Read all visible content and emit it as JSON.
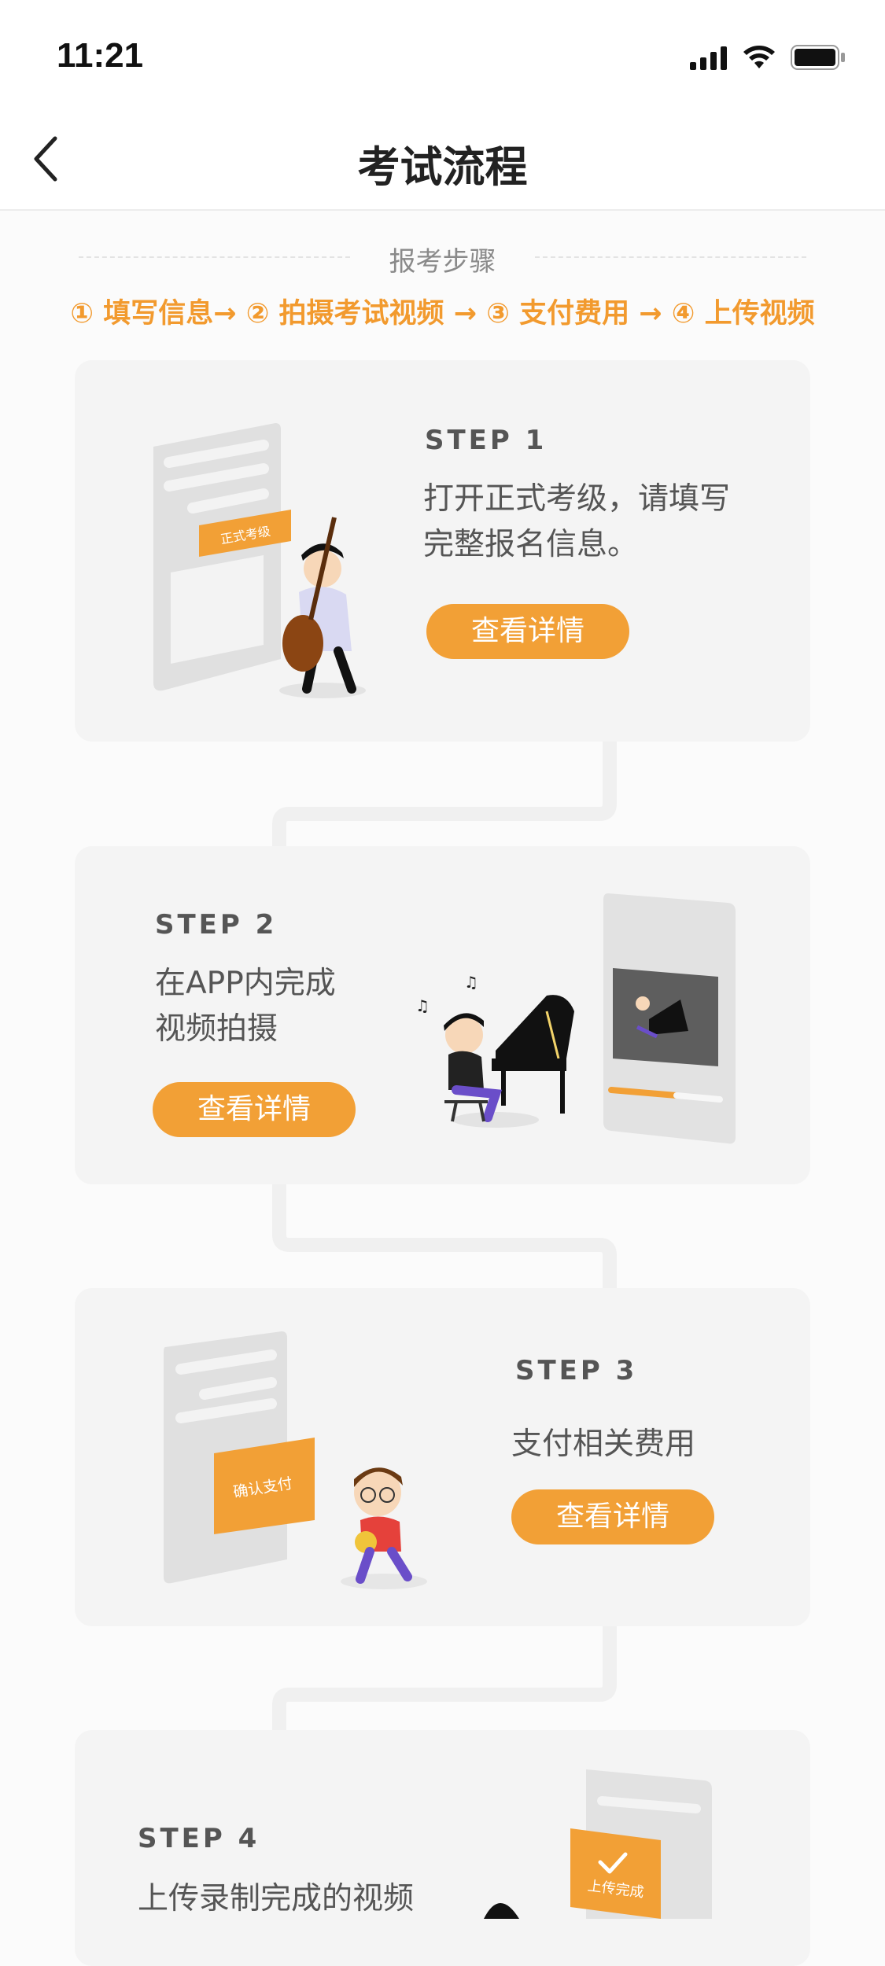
{
  "status_bar": {
    "time": "11:21",
    "icons": [
      "signal-icon",
      "wifi-icon",
      "battery-icon"
    ]
  },
  "nav": {
    "title": "考试流程",
    "back_icon": "chevron-left-icon"
  },
  "section": {
    "label": "报考步骤",
    "flow": "① 填写信息→ ② 拍摄考试视频 → ③ 支付费用 → ④ 上传视频"
  },
  "steps": [
    {
      "label": "STEP 1",
      "desc_line1": "打开正式考级，请填写",
      "desc_line2": "完整报名信息。",
      "button": "查看详情",
      "tag": "正式考级"
    },
    {
      "label": "STEP 2",
      "desc_line1": "在APP内完成",
      "desc_line2": "视频拍摄",
      "button": "查看详情"
    },
    {
      "label": "STEP 3",
      "desc_line1": "支付相关费用",
      "button": "查看详情",
      "tag": "确认支付"
    },
    {
      "label": "STEP 4",
      "desc_line1": "上传录制完成的视频",
      "tag": "上传完成"
    }
  ],
  "colors": {
    "accent": "#f2a036",
    "flow_text": "#f29a2e",
    "card_bg": "#f4f4f4",
    "page_bg": "#fbfbfb"
  }
}
